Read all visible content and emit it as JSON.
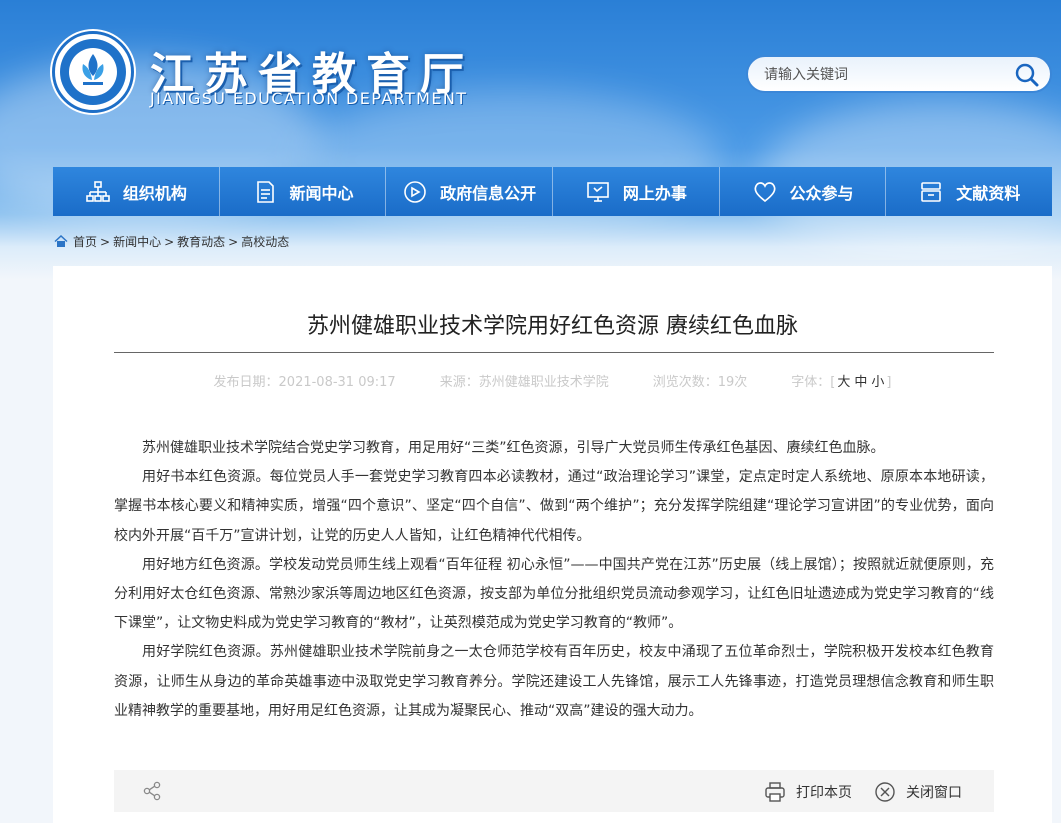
{
  "header": {
    "title": "江苏省教育厅",
    "subtitle": "JIANGSU EDUCATION DEPARTMENT",
    "search_placeholder": "请输入关键词"
  },
  "nav": [
    {
      "label": "组织机构",
      "icon": "org-chart-icon"
    },
    {
      "label": "新闻中心",
      "icon": "document-icon"
    },
    {
      "label": "政府信息公开",
      "icon": "announcement-icon"
    },
    {
      "label": "网上办事",
      "icon": "monitor-icon"
    },
    {
      "label": "公众参与",
      "icon": "heart-icon"
    },
    {
      "label": "文献资料",
      "icon": "archive-icon"
    }
  ],
  "breadcrumb": {
    "items": [
      "首页",
      "新闻中心",
      "教育动态",
      "高校动态"
    ],
    "separator": ">"
  },
  "article": {
    "title": "苏州健雄职业技术学院用好红色资源 赓续红色血脉",
    "date_label": "发布日期：2021-08-31 09:17",
    "source_label": "来源：苏州健雄职业技术学院",
    "views_label": "浏览次数：19次",
    "font_label": "字体：",
    "font_bracket_open": "[",
    "font_bracket_close": "]",
    "font_sizes": [
      "大",
      "中",
      "小"
    ],
    "paragraphs": [
      "苏州健雄职业技术学院结合党史学习教育，用足用好“三类”红色资源，引导广大党员师生传承红色基因、赓续红色血脉。",
      "用好书本红色资源。每位党员人手一套党史学习教育四本必读教材，通过“政治理论学习”课堂，定点定时定人系统地、原原本本地研读，掌握书本核心要义和精神实质，增强“四个意识”、坚定“四个自信”、做到“两个维护”；充分发挥学院组建“理论学习宣讲团”的专业优势，面向校内外开展“百千万”宣讲计划，让党的历史人人皆知，让红色精神代代相传。",
      "用好地方红色资源。学校发动党员师生线上观看“百年征程 初心永恒”——中国共产党在江苏”历史展（线上展馆）；按照就近就便原则，充分利用好太仓红色资源、常熟沙家浜等周边地区红色资源，按支部为单位分批组织党员流动参观学习，让红色旧址遗迹成为党史学习教育的“线下课堂”，让文物史料成为党史学习教育的“教材”，让英烈模范成为党史学习教育的“教师”。",
      "用好学院红色资源。苏州健雄职业技术学院前身之一太仓师范学校有百年历史，校友中涌现了五位革命烈士，学院积极开发校本红色教育资源，让师生从身边的革命英雄事迹中汲取党史学习教育养分。学院还建设工人先锋馆，展示工人先锋事迹，打造党员理想信念教育和师生职业精神教学的重要基地，用好用足红色资源，让其成为凝聚民心、推动“双高”建设的强大动力。"
    ]
  },
  "footer": {
    "print_label": "打印本页",
    "close_label": "关闭窗口"
  }
}
